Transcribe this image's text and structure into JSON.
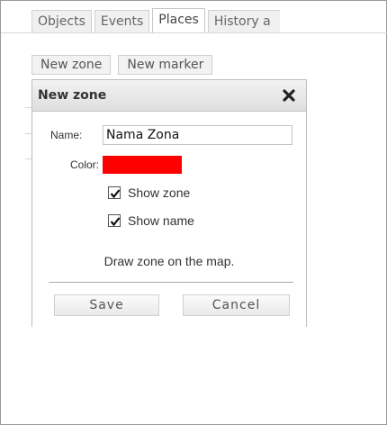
{
  "tabs": [
    {
      "label": "Objects",
      "active": false
    },
    {
      "label": "Events",
      "active": false
    },
    {
      "label": "Places",
      "active": true
    },
    {
      "label": "History a",
      "active": false
    }
  ],
  "actions": {
    "new_zone": "New zone",
    "new_marker": "New marker"
  },
  "dialog": {
    "title": "New zone",
    "close_icon": "close-x-icon",
    "name_label": "Name:",
    "name_value": "Nama Zona",
    "color_label": "Color:",
    "color_value": "#ff0000",
    "show_zone_label": "Show zone",
    "show_zone_checked": true,
    "show_name_label": "Show name",
    "show_name_checked": true,
    "hint": "Draw zone on the map.",
    "save_label": "Save",
    "cancel_label": "Cancel"
  }
}
